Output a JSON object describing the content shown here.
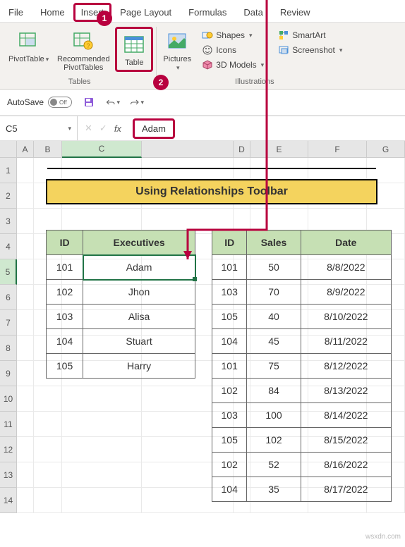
{
  "ribbon": {
    "tabs": [
      "File",
      "Home",
      "Insert",
      "Page Layout",
      "Formulas",
      "Data",
      "Review"
    ],
    "tables_group": {
      "pivottable": "PivotTable",
      "recommended": "Recommended\nPivotTables",
      "table": "Table",
      "label": "Tables"
    },
    "illustrations_group": {
      "pictures": "Pictures",
      "shapes": "Shapes",
      "icons": "Icons",
      "models": "3D Models",
      "smartart": "SmartArt",
      "screenshot": "Screenshot",
      "label": "Illustrations"
    }
  },
  "qa": {
    "autosave": "AutoSave",
    "off": "Off"
  },
  "fbar": {
    "cellref": "C5",
    "value": "Adam"
  },
  "columns": [
    "",
    "A",
    "B",
    "C",
    "",
    "D",
    "E",
    "F",
    "G"
  ],
  "rows": [
    "1",
    "2",
    "3",
    "4",
    "5",
    "6",
    "7",
    "8",
    "9",
    "10",
    "11",
    "12",
    "13",
    "14"
  ],
  "title": "Using Relationships Toolbar",
  "exec": {
    "headers": [
      "ID",
      "Executives"
    ],
    "rows": [
      [
        "101",
        "Adam"
      ],
      [
        "102",
        "Jhon"
      ],
      [
        "103",
        "Alisa"
      ],
      [
        "104",
        "Stuart"
      ],
      [
        "105",
        "Harry"
      ]
    ]
  },
  "sales": {
    "headers": [
      "ID",
      "Sales",
      "Date"
    ],
    "rows": [
      [
        "101",
        "50",
        "8/8/2022"
      ],
      [
        "103",
        "70",
        "8/9/2022"
      ],
      [
        "105",
        "40",
        "8/10/2022"
      ],
      [
        "104",
        "45",
        "8/11/2022"
      ],
      [
        "101",
        "75",
        "8/12/2022"
      ],
      [
        "102",
        "84",
        "8/13/2022"
      ],
      [
        "103",
        "100",
        "8/14/2022"
      ],
      [
        "105",
        "102",
        "8/15/2022"
      ],
      [
        "102",
        "52",
        "8/16/2022"
      ],
      [
        "104",
        "35",
        "8/17/2022"
      ]
    ]
  },
  "callouts": {
    "one": "1",
    "two": "2"
  },
  "watermark": "wsxdn.com"
}
